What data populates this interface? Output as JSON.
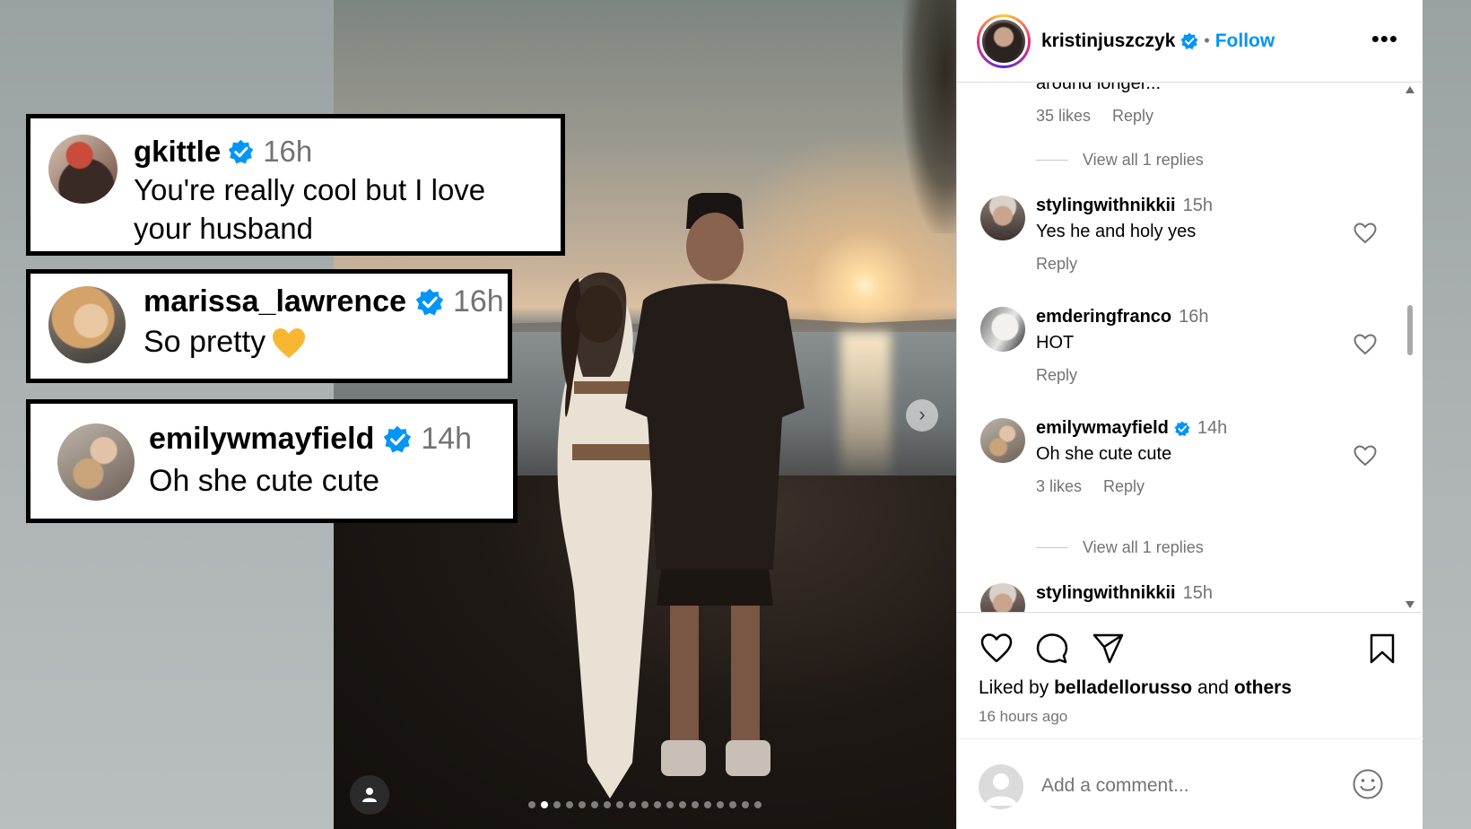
{
  "overlay_cards": [
    {
      "username": "gkittle",
      "time": "16h",
      "text": "You're really cool but I love your husband",
      "emoji": ""
    },
    {
      "username": "marissa_lawrence",
      "time": "16h",
      "text": "So pretty",
      "emoji": "yellow-heart"
    },
    {
      "username": "emilywmayfield",
      "time": "14h",
      "text": "Oh she cute cute",
      "emoji": ""
    }
  ],
  "post": {
    "author": "kristinjuszczyk",
    "follow_label": "Follow",
    "more_label": "•••",
    "truncated_text": "around longer...",
    "carousel": {
      "total_slides": 19,
      "active_index": 1
    }
  },
  "thread": {
    "prev_meta": {
      "likes": "35 likes",
      "reply": "Reply"
    },
    "view_replies_1": "View all 1 replies",
    "comments": [
      {
        "username": "stylingwithnikkii",
        "time": "15h",
        "text": "Yes he and holy yes",
        "meta_reply": "Reply",
        "likes": ""
      },
      {
        "username": "emderingfranco",
        "time": "16h",
        "text": "HOT",
        "meta_reply": "Reply",
        "likes": ""
      },
      {
        "username": "emilywmayfield",
        "time": "14h",
        "text": "Oh she cute cute",
        "meta_reply": "Reply",
        "likes": "3 likes",
        "verified": true
      },
      {
        "username": "stylingwithnikkii",
        "time": "15h",
        "text": "",
        "meta_reply": "",
        "likes": ""
      }
    ],
    "view_replies_2": "View all 1 replies"
  },
  "actions": {
    "liked_prefix": "Liked by",
    "liked_user": "belladellorusso",
    "liked_and": "and",
    "liked_others": "others",
    "time_ago": "16 hours ago",
    "comment_placeholder": "Add a comment..."
  },
  "colors": {
    "verified_blue": "#0095f6",
    "follow_blue": "#0095f6",
    "muted_text": "#737373"
  }
}
